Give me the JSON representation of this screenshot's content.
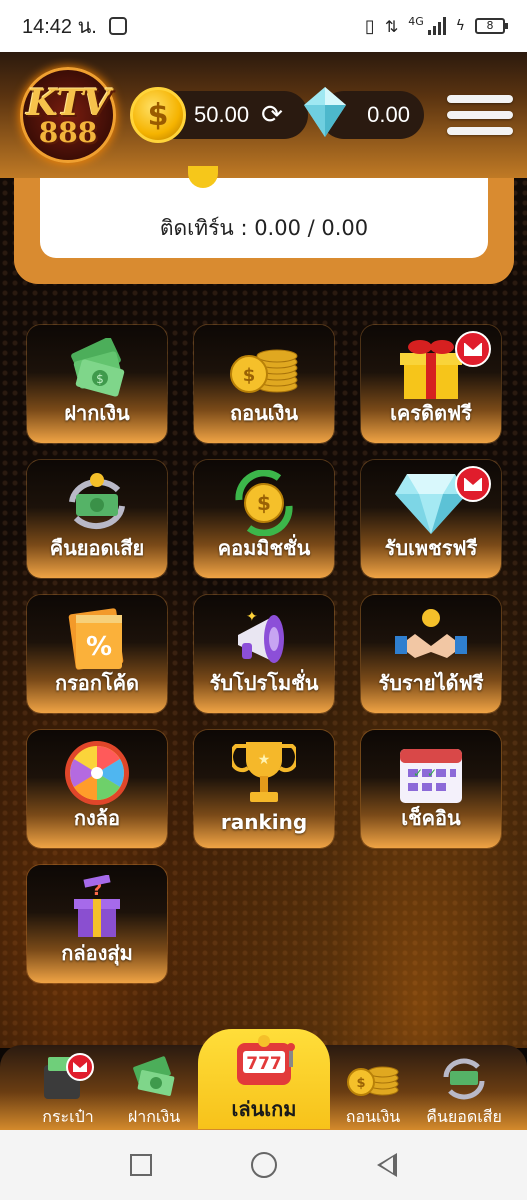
{
  "status_bar": {
    "time": "14:42 น.",
    "network": "4G",
    "battery": "8"
  },
  "header": {
    "logo_text": "KTV",
    "logo_number": "888",
    "coin_symbol": "$",
    "coin_balance": "50.00",
    "refresh_icon": "⟳",
    "gem_balance": "0.00"
  },
  "withdraw_card": {
    "text": "ติดเทิร์น : 0.00 / 0.00"
  },
  "menu": {
    "items": [
      {
        "label": "ฝากเงิน",
        "icon": "cash-icon"
      },
      {
        "label": "ถอนเงิน",
        "icon": "coins-stack-icon"
      },
      {
        "label": "เครดิตฟรี",
        "icon": "gift-box-icon",
        "badge": "mail"
      },
      {
        "label": "คืนยอดเสีย",
        "icon": "cashback-icon"
      },
      {
        "label": "คอมมิชชั่น",
        "icon": "commission-coin-icon"
      },
      {
        "label": "รับเพชรฟรี",
        "icon": "diamond-icon",
        "badge": "mail"
      },
      {
        "label": "กรอกโค้ด",
        "icon": "coupon-icon"
      },
      {
        "label": "รับโปรโมชั่น",
        "icon": "megaphone-icon"
      },
      {
        "label": "รับรายได้ฟรี",
        "icon": "handshake-icon"
      },
      {
        "label": "กงล้อ",
        "icon": "wheel-icon"
      },
      {
        "label": "ranking",
        "icon": "trophy-icon"
      },
      {
        "label": "เช็คอิน",
        "icon": "calendar-icon"
      },
      {
        "label": "กล่องสุ่ม",
        "icon": "mystery-box-icon"
      }
    ]
  },
  "bottom_nav": {
    "wallet": "กระเป๋า",
    "deposit": "ฝากเงิน",
    "play": "เล่นเกม",
    "withdraw": "ถอนเงิน",
    "cashback": "คืนยอดเสีย",
    "slot_text": "777"
  },
  "colors": {
    "accent_orange": "#d98b30",
    "play_yellow": "#f7c21a",
    "badge_red": "#e01d2c"
  }
}
